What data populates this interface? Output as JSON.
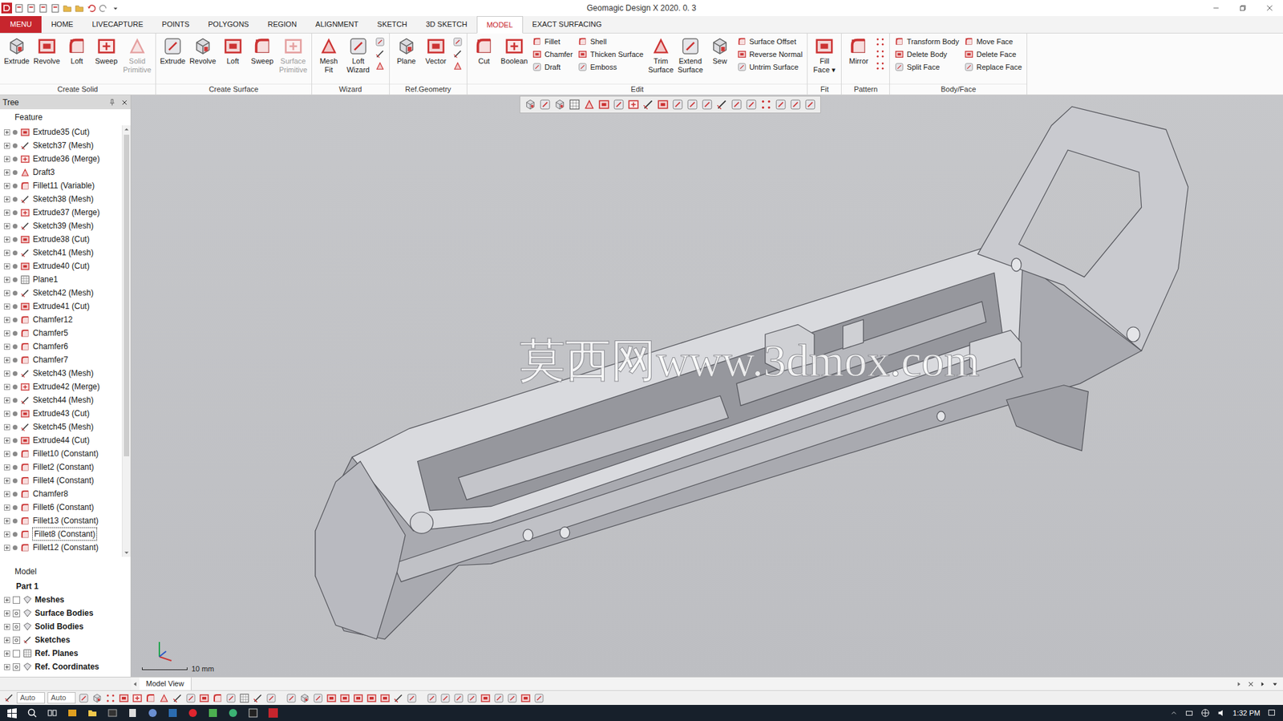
{
  "window": {
    "title": "Geomagic Design X 2020. 0. 3"
  },
  "ribbon_tabs": [
    {
      "label": "MENU",
      "kind": "menu",
      "selected": false
    },
    {
      "label": "HOME",
      "kind": "tab",
      "selected": false
    },
    {
      "label": "LIVECAPTURE",
      "kind": "tab",
      "selected": false
    },
    {
      "label": "POINTS",
      "kind": "tab",
      "selected": false
    },
    {
      "label": "POLYGONS",
      "kind": "tab",
      "selected": false
    },
    {
      "label": "REGION",
      "kind": "tab",
      "selected": false
    },
    {
      "label": "ALIGNMENT",
      "kind": "tab",
      "selected": false
    },
    {
      "label": "SKETCH",
      "kind": "tab",
      "selected": false
    },
    {
      "label": "3D SKETCH",
      "kind": "tab",
      "selected": false
    },
    {
      "label": "MODEL",
      "kind": "tab",
      "selected": true
    },
    {
      "label": "EXACT SURFACING",
      "kind": "tab",
      "selected": false
    }
  ],
  "ribbon_groups": [
    {
      "label": "Create Solid",
      "items": [
        {
          "kind": "large",
          "label": "Extrude",
          "disabled": false
        },
        {
          "kind": "large",
          "label": "Revolve",
          "disabled": false
        },
        {
          "kind": "large",
          "label": "Loft",
          "disabled": false
        },
        {
          "kind": "large",
          "label": "Sweep",
          "disabled": false
        },
        {
          "kind": "large",
          "label": "Solid\nPrimitive",
          "disabled": true
        }
      ]
    },
    {
      "label": "Create Surface",
      "items": [
        {
          "kind": "large",
          "label": "Extrude",
          "disabled": false
        },
        {
          "kind": "large",
          "label": "Revolve",
          "disabled": false
        },
        {
          "kind": "large",
          "label": "Loft",
          "disabled": false
        },
        {
          "kind": "large",
          "label": "Sweep",
          "disabled": false
        },
        {
          "kind": "large",
          "label": "Surface\nPrimitive",
          "disabled": true
        }
      ]
    },
    {
      "label": "Wizard",
      "items": [
        {
          "kind": "large",
          "label": "Mesh\nFit",
          "disabled": false
        },
        {
          "kind": "large",
          "label": "Loft\nWizard",
          "disabled": false
        },
        {
          "kind": "icons"
        }
      ]
    },
    {
      "label": "Ref.Geometry",
      "items": [
        {
          "kind": "large",
          "label": "Plane",
          "disabled": false
        },
        {
          "kind": "large",
          "label": "Vector",
          "disabled": false
        },
        {
          "kind": "icons"
        }
      ]
    },
    {
      "label": "Edit",
      "items": [
        {
          "kind": "large",
          "label": "Cut",
          "disabled": false
        },
        {
          "kind": "large",
          "label": "Boolean",
          "disabled": false
        },
        {
          "kind": "column",
          "tools": [
            "Fillet",
            "Chamfer",
            "Draft"
          ]
        },
        {
          "kind": "column",
          "tools": [
            "Shell",
            "Thicken Surface",
            "Emboss"
          ]
        },
        {
          "kind": "large",
          "label": "Trim\nSurface",
          "disabled": false
        },
        {
          "kind": "large",
          "label": "Extend\nSurface",
          "disabled": false
        },
        {
          "kind": "large",
          "label": "Sew",
          "disabled": false
        },
        {
          "kind": "column",
          "tools": [
            "Surface Offset",
            "Reverse Normal",
            "Untrim Surface"
          ]
        }
      ]
    },
    {
      "label": "Fit",
      "items": [
        {
          "kind": "large",
          "label": "Fill\nFace ▾",
          "disabled": false
        }
      ]
    },
    {
      "label": "Pattern",
      "items": [
        {
          "kind": "large",
          "label": "Mirror",
          "disabled": false
        },
        {
          "kind": "icons"
        }
      ]
    },
    {
      "label": "Body/Face",
      "items": [
        {
          "kind": "column",
          "tools": [
            "Transform Body",
            "Delete Body",
            "Split Face"
          ]
        },
        {
          "kind": "column",
          "tools": [
            "Move Face",
            "Delete Face",
            "Replace Face"
          ]
        }
      ]
    }
  ],
  "tree": {
    "title": "Tree",
    "section": "Feature",
    "features": [
      {
        "label": "Extrude35 (Cut)",
        "kind": "cut",
        "selected": false
      },
      {
        "label": "Sketch37 (Mesh)",
        "kind": "sketch",
        "selected": false
      },
      {
        "label": "Extrude36 (Merge)",
        "kind": "merge",
        "selected": false
      },
      {
        "label": "Draft3",
        "kind": "draft",
        "selected": false
      },
      {
        "label": "Fillet11 (Variable)",
        "kind": "fillet",
        "selected": false
      },
      {
        "label": "Sketch38 (Mesh)",
        "kind": "sketch",
        "selected": false
      },
      {
        "label": "Extrude37 (Merge)",
        "kind": "merge",
        "selected": false
      },
      {
        "label": "Sketch39 (Mesh)",
        "kind": "sketch",
        "selected": false
      },
      {
        "label": "Extrude38 (Cut)",
        "kind": "cut",
        "selected": false
      },
      {
        "label": "Sketch41 (Mesh)",
        "kind": "sketch",
        "selected": false
      },
      {
        "label": "Extrude40 (Cut)",
        "kind": "cut",
        "selected": false
      },
      {
        "label": "Plane1",
        "kind": "plane",
        "selected": false
      },
      {
        "label": "Sketch42 (Mesh)",
        "kind": "sketch",
        "selected": false
      },
      {
        "label": "Extrude41 (Cut)",
        "kind": "cut",
        "selected": false
      },
      {
        "label": "Chamfer12",
        "kind": "fillet",
        "selected": false
      },
      {
        "label": "Chamfer5",
        "kind": "fillet",
        "selected": false
      },
      {
        "label": "Chamfer6",
        "kind": "fillet",
        "selected": false
      },
      {
        "label": "Chamfer7",
        "kind": "fillet",
        "selected": false
      },
      {
        "label": "Sketch43 (Mesh)",
        "kind": "sketch",
        "selected": false
      },
      {
        "label": "Extrude42 (Merge)",
        "kind": "merge",
        "selected": false
      },
      {
        "label": "Sketch44 (Mesh)",
        "kind": "sketch",
        "selected": false
      },
      {
        "label": "Extrude43 (Cut)",
        "kind": "cut",
        "selected": false
      },
      {
        "label": "Sketch45 (Mesh)",
        "kind": "sketch",
        "selected": false
      },
      {
        "label": "Extrude44 (Cut)",
        "kind": "cut",
        "selected": false
      },
      {
        "label": "Fillet10 (Constant)",
        "kind": "fillet",
        "selected": false
      },
      {
        "label": "Fillet2 (Constant)",
        "kind": "fillet",
        "selected": false
      },
      {
        "label": "Fillet4 (Constant)",
        "kind": "fillet",
        "selected": false
      },
      {
        "label": "Chamfer8",
        "kind": "fillet",
        "selected": false
      },
      {
        "label": "Fillet6 (Constant)",
        "kind": "fillet",
        "selected": false
      },
      {
        "label": "Fillet13 (Constant)",
        "kind": "fillet",
        "selected": false
      },
      {
        "label": "Fillet8 (Constant)",
        "kind": "fillet",
        "selected": true
      },
      {
        "label": "Fillet12 (Constant)",
        "kind": "fillet",
        "selected": false
      }
    ],
    "model_title": "Model",
    "model_items": [
      {
        "label": "Part 1",
        "kind": "part"
      },
      {
        "label": "Meshes",
        "kind": "node",
        "visible": false
      },
      {
        "label": "Surface Bodies",
        "kind": "node",
        "visible": true
      },
      {
        "label": "Solid Bodies",
        "kind": "node",
        "visible": true
      },
      {
        "label": "Sketches",
        "kind": "node",
        "visible": true
      },
      {
        "label": "Ref. Planes",
        "kind": "node",
        "visible": false
      },
      {
        "label": "Ref. Coordinates",
        "kind": "node",
        "visible": true
      }
    ]
  },
  "viewport": {
    "watermark": "莫西网www.3dmox.com",
    "scale": "10 mm",
    "tab": "Model View"
  },
  "status_bar": {
    "fields": [
      "Auto",
      "Auto"
    ]
  },
  "taskbar": {
    "time": "1:32 PM"
  }
}
